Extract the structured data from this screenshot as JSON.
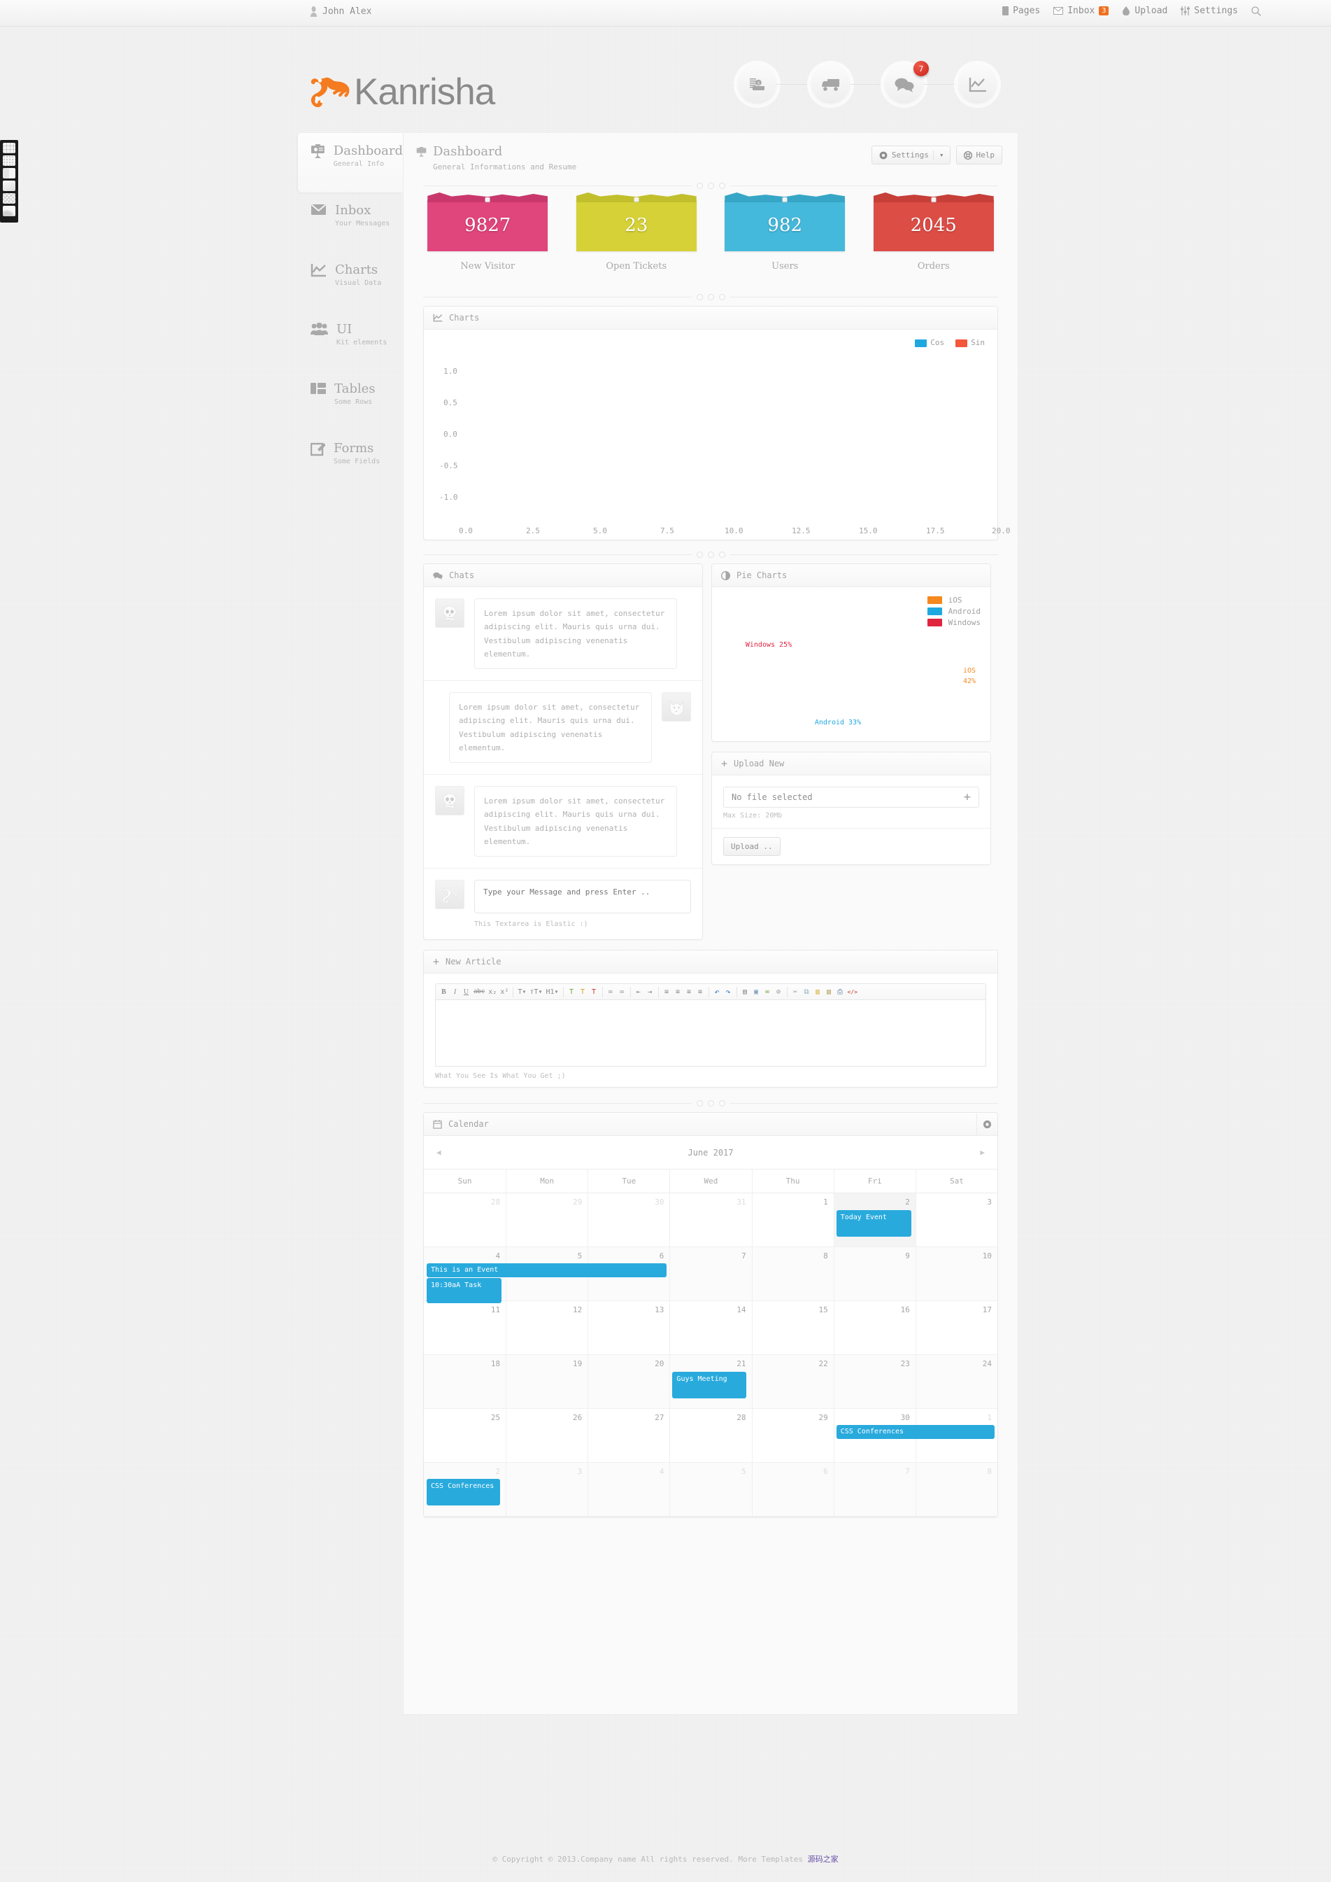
{
  "topbar": {
    "user": "John Alex",
    "items": [
      {
        "label": "Pages",
        "icon": "pages-icon"
      },
      {
        "label": "Inbox",
        "icon": "inbox-icon",
        "badge": "3"
      },
      {
        "label": "Upload",
        "icon": "upload-icon"
      },
      {
        "label": "Settings",
        "icon": "settings-sliders-icon"
      }
    ],
    "search_icon": "search-icon"
  },
  "brand": {
    "name": "Kanrisha",
    "logo_icon": "gecko-logo-icon",
    "logo_color": "#f47b20"
  },
  "circlenav": [
    {
      "icon": "coins-money-icon",
      "badge": ""
    },
    {
      "icon": "truck-delivery-icon",
      "badge": ""
    },
    {
      "icon": "chat-bubbles-icon",
      "badge": "7"
    },
    {
      "icon": "line-chart-icon",
      "badge": ""
    }
  ],
  "sidebar": {
    "items": [
      {
        "title": "Dashboard",
        "sub": "General Info",
        "icon": "presentation-board-icon",
        "active": true
      },
      {
        "title": "Inbox",
        "sub": "Your Messages",
        "icon": "envelope-icon",
        "active": false
      },
      {
        "title": "Charts",
        "sub": "Visual Data",
        "icon": "line-chart-icon",
        "active": false
      },
      {
        "title": "UI",
        "sub": "Kit elements",
        "icon": "users-group-icon",
        "active": false
      },
      {
        "title": "Tables",
        "sub": "Some Rows",
        "icon": "table-columns-icon",
        "active": false
      },
      {
        "title": "Forms",
        "sub": "Some Fields",
        "icon": "pencil-square-icon",
        "active": false
      }
    ]
  },
  "page": {
    "title": "Dashboard",
    "subtitle": "General Informations and Resume",
    "icon": "presentation-board-icon",
    "settings_label": "Settings",
    "help_label": "Help"
  },
  "stats": [
    {
      "value": "9827",
      "label": "New Visitor",
      "color": "#e0457b"
    },
    {
      "value": "23",
      "label": "Open Tickets",
      "color": "#d5d137"
    },
    {
      "value": "982",
      "label": "Users",
      "color": "#45b9db"
    },
    {
      "value": "2045",
      "label": "Orders",
      "color": "#dc4d46"
    }
  ],
  "charts_panel": {
    "title": "Charts",
    "icon": "line-chart-icon"
  },
  "chart_data": [
    {
      "type": "line",
      "title": "Charts",
      "series": [
        {
          "name": "Cos",
          "color": "#1fa8e0",
          "values": []
        },
        {
          "name": "Sin",
          "color": "#f4563c",
          "values": []
        }
      ],
      "xlabel": "",
      "ylabel": "",
      "xticks": [
        "0.0",
        "2.5",
        "5.0",
        "7.5",
        "10.0",
        "12.5",
        "15.0",
        "17.5",
        "20.0"
      ],
      "yticks": [
        "1.0",
        "0.5",
        "0.0",
        "-0.5",
        "-1.0"
      ],
      "xlim": [
        0.0,
        20.0
      ],
      "ylim": [
        -1.0,
        1.0
      ],
      "grid": false,
      "legend_position": "top-right"
    },
    {
      "type": "pie",
      "title": "Pie Charts",
      "categories": [
        "iOS",
        "Android",
        "Windows"
      ],
      "values": [
        42,
        33,
        25
      ],
      "colors": [
        "#f5881f",
        "#1fa8e0",
        "#e0253f"
      ],
      "labels": [
        "iOS 42%",
        "Android 33%",
        "Windows 25%"
      ],
      "legend_position": "top-right"
    }
  ],
  "chats": {
    "title": "Chats",
    "icon": "chat-bubbles-icon",
    "messages": [
      {
        "side": "left",
        "avatar": "skull-avatar-icon",
        "text": "Lorem ipsum dolor sit amet, consectetur adipiscing elit. Mauris quis urna dui. Vestibulum adipiscing venenatis elementum."
      },
      {
        "side": "right",
        "avatar": "fox-avatar-icon",
        "text": "Lorem ipsum dolor sit amet, consectetur adipiscing elit. Mauris quis urna dui. Vestibulum adipiscing venenatis elementum."
      },
      {
        "side": "left",
        "avatar": "skull-avatar-icon",
        "text": "Lorem ipsum dolor sit amet, consectetur adipiscing elit. Mauris quis urna dui. Vestibulum adipiscing venenatis elementum."
      }
    ],
    "compose": {
      "avatar": "gecko-avatar-icon",
      "placeholder": "Type your Message and press Enter ..",
      "hint": "This Textarea is Elastic :)"
    }
  },
  "pie_panel": {
    "title": "Pie Charts",
    "icon": "pie-chart-icon"
  },
  "upload": {
    "title": "Upload New",
    "icon": "plus-icon",
    "file_value": "No file selected",
    "add_icon": "plus-icon",
    "max_size": "Max Size: 20Mb",
    "button": "Upload .."
  },
  "article": {
    "title": "New Article",
    "icon": "plus-icon",
    "hint": "What You See Is What You Get ;)",
    "toolbar": [
      {
        "g": [
          {
            "n": "bold-icon",
            "t": "B"
          },
          {
            "n": "italic-icon",
            "t": "I"
          },
          {
            "n": "underline-icon",
            "t": "U"
          },
          {
            "n": "strikethrough-icon",
            "t": "abc"
          },
          {
            "n": "subscript-icon",
            "t": "x₂"
          },
          {
            "n": "superscript-icon",
            "t": "x²"
          }
        ]
      },
      {
        "g": [
          {
            "n": "font-size-icon",
            "t": "T▾"
          },
          {
            "n": "font-smaller-icon",
            "t": "тT▾"
          },
          {
            "n": "heading-icon",
            "t": "H1▾"
          }
        ]
      },
      {
        "g": [
          {
            "n": "text-color-icon",
            "t": "T"
          },
          {
            "n": "highlight-color-icon",
            "t": "T"
          },
          {
            "n": "remove-format-icon",
            "t": "T"
          }
        ]
      },
      {
        "g": [
          {
            "n": "bullet-list-icon",
            "t": "≔"
          },
          {
            "n": "numbered-list-icon",
            "t": "≕"
          }
        ]
      },
      {
        "g": [
          {
            "n": "outdent-icon",
            "t": "⇤"
          },
          {
            "n": "indent-icon",
            "t": "⇥"
          }
        ]
      },
      {
        "g": [
          {
            "n": "align-left-icon",
            "t": "≡"
          },
          {
            "n": "align-center-icon",
            "t": "≡"
          },
          {
            "n": "align-right-icon",
            "t": "≡"
          },
          {
            "n": "align-justify-icon",
            "t": "≡"
          }
        ]
      },
      {
        "g": [
          {
            "n": "undo-icon",
            "t": "↶"
          },
          {
            "n": "redo-icon",
            "t": "↷"
          }
        ]
      },
      {
        "g": [
          {
            "n": "horizontal-rule-icon",
            "t": "▤"
          },
          {
            "n": "insert-image-icon",
            "t": "▣"
          },
          {
            "n": "insert-link-icon",
            "t": "🔗"
          },
          {
            "n": "unlink-icon",
            "t": "⛓"
          }
        ]
      },
      {
        "g": [
          {
            "n": "cut-icon",
            "t": "✂"
          },
          {
            "n": "copy-icon",
            "t": "⧉"
          },
          {
            "n": "paste-icon",
            "t": "📋"
          },
          {
            "n": "paste-text-icon",
            "t": "📋"
          },
          {
            "n": "print-icon",
            "t": "🖶"
          },
          {
            "n": "source-code-icon",
            "t": "</>"
          }
        ]
      }
    ]
  },
  "calendar": {
    "title": "Calendar",
    "icon": "calendar-icon",
    "gear_icon": "gear-icon",
    "prev_icon": "chevron-left-icon",
    "next_icon": "chevron-right-icon",
    "month": "June 2017",
    "weekdays": [
      "Sun",
      "Mon",
      "Tue",
      "Wed",
      "Thu",
      "Fri",
      "Sat"
    ],
    "weeks": [
      [
        {
          "d": "28",
          "out": true
        },
        {
          "d": "29",
          "out": true
        },
        {
          "d": "30",
          "out": true
        },
        {
          "d": "31",
          "out": true
        },
        {
          "d": "1"
        },
        {
          "d": "2",
          "today": true
        },
        {
          "d": "3"
        }
      ],
      [
        {
          "d": "4"
        },
        {
          "d": "5"
        },
        {
          "d": "6"
        },
        {
          "d": "7"
        },
        {
          "d": "8"
        },
        {
          "d": "9"
        },
        {
          "d": "10"
        }
      ],
      [
        {
          "d": "11"
        },
        {
          "d": "12"
        },
        {
          "d": "13"
        },
        {
          "d": "14"
        },
        {
          "d": "15"
        },
        {
          "d": "16"
        },
        {
          "d": "17"
        }
      ],
      [
        {
          "d": "18"
        },
        {
          "d": "19"
        },
        {
          "d": "20"
        },
        {
          "d": "21"
        },
        {
          "d": "22"
        },
        {
          "d": "23"
        },
        {
          "d": "24"
        }
      ],
      [
        {
          "d": "25"
        },
        {
          "d": "26"
        },
        {
          "d": "27"
        },
        {
          "d": "28"
        },
        {
          "d": "29"
        },
        {
          "d": "30"
        },
        {
          "d": "1",
          "out": true
        }
      ],
      [
        {
          "d": "2",
          "out": true
        },
        {
          "d": "3",
          "out": true
        },
        {
          "d": "4",
          "out": true
        },
        {
          "d": "5",
          "out": true
        },
        {
          "d": "6",
          "out": true
        },
        {
          "d": "7",
          "out": true
        },
        {
          "d": "8",
          "out": true
        }
      ]
    ],
    "events": [
      {
        "text": "Today Event",
        "week": 0,
        "col": 5,
        "span": 1,
        "color": "#29aadd"
      },
      {
        "text": "This is an Event",
        "week": 1,
        "col": 0,
        "span": 3,
        "color": "#29aadd"
      },
      {
        "text": "10:30aA Task",
        "week": 1,
        "col": 0,
        "span": 1,
        "color": "#29aadd",
        "offset": 2
      },
      {
        "text": "Guys Meeting",
        "week": 2,
        "col": 3,
        "span": 1,
        "color": "#29aadd"
      },
      {
        "text": "CSS Conferences",
        "week": 3,
        "col": 5,
        "span": 2,
        "color": "#29aadd"
      },
      {
        "text": "CSS Conferences",
        "week": 4,
        "col": 0,
        "span": 1,
        "color": "#29aadd"
      }
    ]
  },
  "footer": {
    "text": "© Copyright © 2013.Company name All rights reserved. More Templates",
    "link": "源码之家"
  }
}
